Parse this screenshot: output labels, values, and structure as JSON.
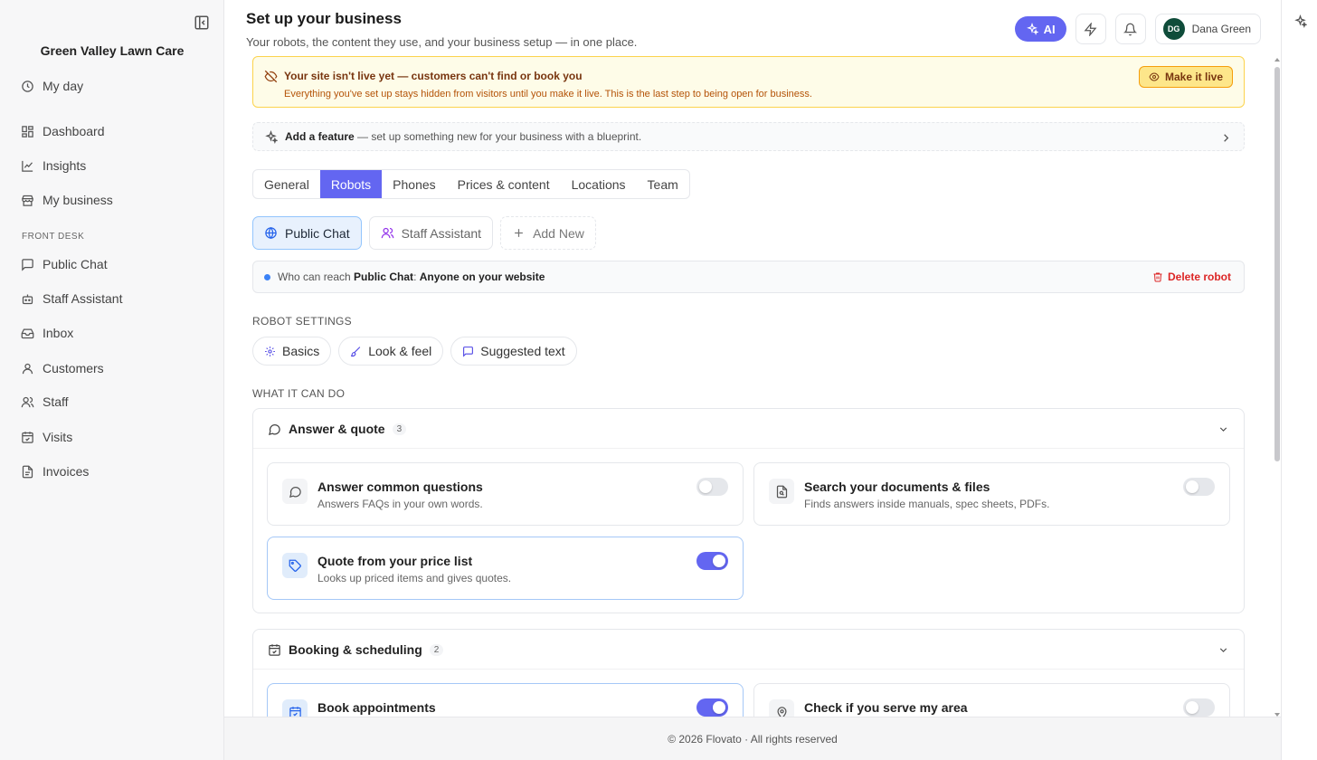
{
  "sidebar": {
    "brand": "Green Valley Lawn Care",
    "items": [
      {
        "label": "My day"
      },
      {
        "label": "Dashboard"
      },
      {
        "label": "Insights"
      },
      {
        "label": "My business"
      }
    ],
    "section": "FRONT DESK",
    "front_desk": [
      {
        "label": "Public Chat"
      },
      {
        "label": "Staff Assistant"
      },
      {
        "label": "Inbox"
      },
      {
        "label": "Customers"
      },
      {
        "label": "Staff"
      },
      {
        "label": "Visits"
      },
      {
        "label": "Invoices"
      }
    ]
  },
  "header": {
    "title": "Set up your business",
    "subtitle": "Your robots, the content they use, and your business setup — in one place.",
    "ai_label": "AI",
    "user_initials": "DG",
    "user_name": "Dana Green"
  },
  "banner": {
    "title": "Your site isn't live yet — customers can't find or book you",
    "text": "Everything you've set up stays hidden from visitors until you make it live. This is the last step to being open for business.",
    "button": "Make it live"
  },
  "feature_bar": {
    "bold": "Add a feature",
    "text": " — set up something new for your business with a blueprint."
  },
  "tabs": [
    "General",
    "Robots",
    "Phones",
    "Prices & content",
    "Locations",
    "Team"
  ],
  "active_tab": "Robots",
  "robot_tabs": [
    "Public Chat",
    "Staff Assistant",
    "Add New"
  ],
  "reach": {
    "prefix": "Who can reach ",
    "robot": "Public Chat",
    "sep": ": ",
    "audience": "Anyone on your website",
    "delete": "Delete robot"
  },
  "robot_settings": {
    "label": "ROBOT SETTINGS",
    "pills": [
      "Basics",
      "Look & feel",
      "Suggested text"
    ]
  },
  "capabilities": {
    "label": "WHAT IT CAN DO",
    "groups": [
      {
        "title": "Answer & quote",
        "count": "3",
        "cards": [
          {
            "title": "Answer common questions",
            "desc": "Answers FAQs in your own words.",
            "enabled": false
          },
          {
            "title": "Search your documents & files",
            "desc": "Finds answers inside manuals, spec sheets, PDFs.",
            "enabled": false
          },
          {
            "title": "Quote from your price list",
            "desc": "Looks up priced items and gives quotes.",
            "enabled": true
          }
        ]
      },
      {
        "title": "Booking & scheduling",
        "count": "2",
        "cards": [
          {
            "title": "Book appointments",
            "desc": "",
            "enabled": true
          },
          {
            "title": "Check if you serve my area",
            "desc": "",
            "enabled": false
          }
        ]
      }
    ]
  },
  "footer": "© 2026 Flovato · All rights reserved",
  "colors": {
    "accent": "#6366f1",
    "warning_bg": "#fefce8",
    "danger": "#dc2626"
  }
}
